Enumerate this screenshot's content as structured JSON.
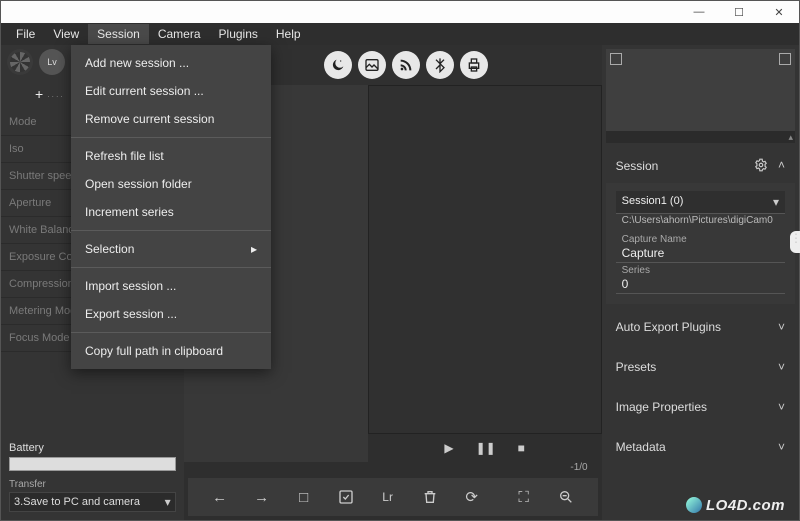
{
  "menubar": [
    "File",
    "View",
    "Session",
    "Camera",
    "Plugins",
    "Help"
  ],
  "menubar_active": 2,
  "window_controls": {
    "min": "—",
    "max": "☐",
    "close": "✕"
  },
  "left": {
    "lv_label": "Lv",
    "add_glyph": "+",
    "dots_glyph": ". . . .",
    "params": [
      "Mode",
      "Iso",
      "Shutter speed",
      "Aperture",
      "White Balance",
      "Exposure Comp",
      "Compression",
      "Metering Mode",
      "Focus Mode"
    ],
    "battery_label": "Battery",
    "transfer_label": "Transfer",
    "transfer_value": "3.Save to PC and camera"
  },
  "toolbar_icons": [
    "moon-icon",
    "image-icon",
    "rss-icon",
    "bluetooth-icon",
    "print-icon"
  ],
  "playback": {
    "play": "▶",
    "pause": "❚❚",
    "stop": "■"
  },
  "count_label": "-1/0",
  "bottom_icons": {
    "back": "←",
    "forward": "→",
    "stop": "□",
    "check": "✓",
    "lr": "Lr",
    "trash": "trash",
    "refresh": "⟳",
    "fullscreen": "⛶",
    "zoom_out": "−"
  },
  "right": {
    "session_title": "Session",
    "session_name": "Session1 (0)",
    "session_path": "C:\\Users\\ahorn\\Pictures\\digiCam0",
    "capture_name_label": "Capture Name",
    "capture_name_value": "Capture",
    "series_label": "Series",
    "series_value": "0",
    "panels": [
      "Auto Export Plugins",
      "Presets",
      "Image Properties",
      "Metadata"
    ]
  },
  "dropdown": {
    "groups": [
      [
        "Add new session ...",
        "Edit current session ...",
        "Remove current session"
      ],
      [
        "Refresh file list",
        "Open session folder",
        "Increment series"
      ],
      [
        {
          "label": "Selection",
          "submenu": true
        }
      ],
      [
        "Import session ...",
        "Export session ..."
      ],
      [
        "Copy full path in clipboard"
      ]
    ]
  },
  "watermark": "LO4D.com"
}
